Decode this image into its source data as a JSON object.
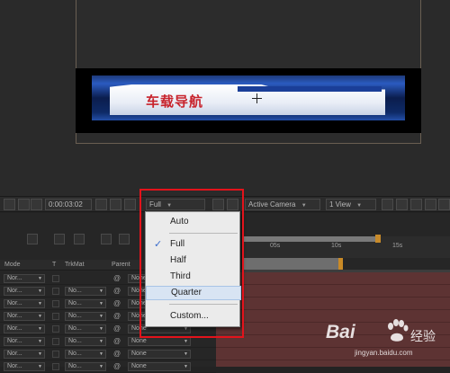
{
  "composition": {
    "banner_title": "车载导航"
  },
  "toolbar": {
    "timecode": "0:00:03:02",
    "resolution": "Full",
    "view_camera": "Active Camera",
    "view_layout": "1 View"
  },
  "resolution_menu": {
    "items": [
      "Auto",
      "Full",
      "Half",
      "Third",
      "Quarter",
      "Custom..."
    ],
    "selected": "Full",
    "highlighted": "Quarter"
  },
  "timeline": {
    "columns": {
      "mode": "Mode",
      "t": "T",
      "trkmat": "TrkMat",
      "parent": "Parent"
    },
    "ticks": [
      "05s",
      "10s",
      "15s"
    ],
    "rows": [
      {
        "mode": "Nor...",
        "trkmat": "",
        "parent": "None"
      },
      {
        "mode": "Nor...",
        "trkmat": "No...",
        "parent": "None"
      },
      {
        "mode": "Nor...",
        "trkmat": "No...",
        "parent": "None"
      },
      {
        "mode": "Nor...",
        "trkmat": "No...",
        "parent": "None"
      },
      {
        "mode": "Nor...",
        "trkmat": "No...",
        "parent": "None"
      },
      {
        "mode": "Nor...",
        "trkmat": "No...",
        "parent": "None"
      },
      {
        "mode": "Nor...",
        "trkmat": "No...",
        "parent": "None"
      },
      {
        "mode": "Nor...",
        "trkmat": "No...",
        "parent": "None"
      }
    ]
  },
  "watermark": {
    "brand": "Bai",
    "cn": "经验",
    "url": "jingyan.baidu.com"
  },
  "colors": {
    "highlight_box": "#e3131b",
    "menu_bg": "#ebebeb",
    "track": "#5d3333"
  }
}
